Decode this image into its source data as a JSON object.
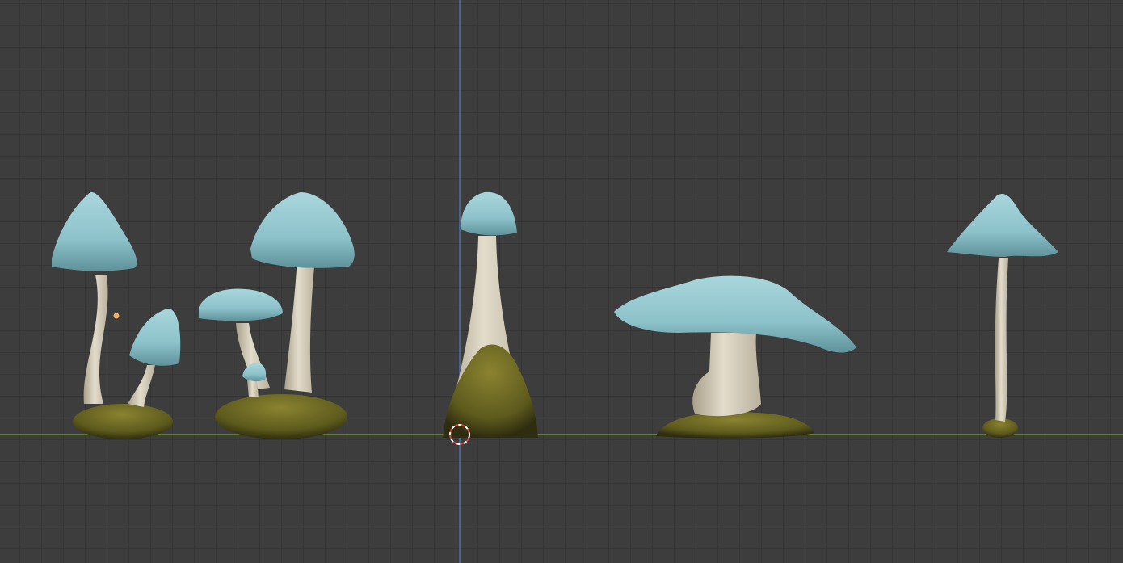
{
  "viewport": {
    "view": "front-orthographic",
    "background_color": "#3d3d3d",
    "grid_color": "#353535",
    "x_axis_color": "#7fa63a",
    "z_axis_color": "#4a78c8",
    "show_grid": true
  },
  "colors": {
    "cap": "#8fc4cc",
    "cap_highlight": "#b6dde2",
    "cap_shadow": "#5d8f98",
    "stem": "#d9d2c0",
    "stem_shadow": "#a79f8a",
    "moss": "#6f6a22",
    "moss_dark": "#3a3712",
    "cursor_red": "#d8403a",
    "light_dot": "#f0b060"
  },
  "objects": [
    {
      "name": "mushroom-group-1",
      "description_icon": "mushroom-icon"
    },
    {
      "name": "mushroom-group-2",
      "description_icon": "mushroom-icon"
    },
    {
      "name": "mushroom-tall-cone",
      "description_icon": "mushroom-icon"
    },
    {
      "name": "mushroom-wide-cap",
      "description_icon": "mushroom-icon"
    },
    {
      "name": "mushroom-thin-stem",
      "description_icon": "mushroom-icon"
    }
  ]
}
